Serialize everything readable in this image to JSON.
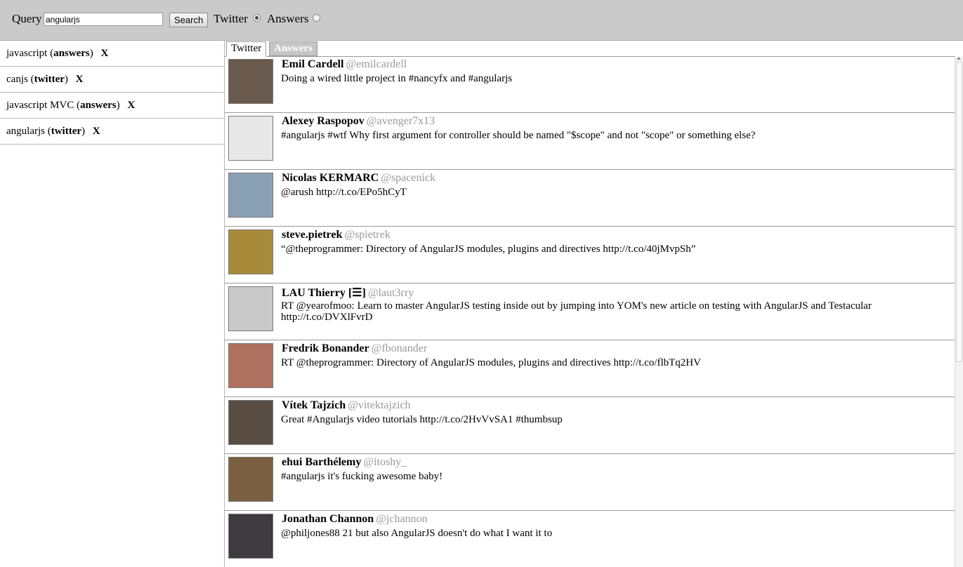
{
  "search": {
    "query_label": "Query",
    "query_value": "angularjs",
    "search_button": "Search",
    "source_twitter_label": "Twitter",
    "source_answers_label": "Answers",
    "selected_source": "Twitter"
  },
  "saved_searches": [
    {
      "term": "javascript",
      "source": "answers",
      "remove": "X"
    },
    {
      "term": "canjs",
      "source": "twitter",
      "remove": "X"
    },
    {
      "term": "javascript MVC",
      "source": "answers",
      "remove": "X"
    },
    {
      "term": "angularjs",
      "source": "twitter",
      "remove": "X"
    }
  ],
  "tabs": {
    "twitter": "Twitter",
    "answers": "Answers",
    "active": "Twitter"
  },
  "tweets": [
    {
      "name": "Emil Cardell",
      "handle": "@emilcardell",
      "text": "Doing a wired little project in #nancyfx and #angularjs",
      "avatar_color": "#6b5a4e"
    },
    {
      "name": "Alexey Raspopov",
      "handle": "@avenger7x13",
      "text": "#angularjs #wtf Why first argument for controller should be named \"$scope\" and not \"scope\" or something else?",
      "avatar_color": "#e8e8e8"
    },
    {
      "name": "Nicolas KERMARC",
      "handle": "@spacenick",
      "text": "@arush http://t.co/EPo5hCyT",
      "avatar_color": "#8aa0b4"
    },
    {
      "name": "steve.pietrek",
      "handle": "@spietrek",
      "text": "“@theprogrammer: Directory of AngularJS modules, plugins and directives http://t.co/40jMvpSh”",
      "avatar_color": "#a88b3a"
    },
    {
      "name": "LAU Thierry [☰]",
      "handle": "@laut3rry",
      "text": "RT @yearofmoo: Learn to master AngularJS testing inside out by jumping into YOM's new article on testing with AngularJS and Testacular http://t.co/DVXlFvrD",
      "avatar_color": "#c9c9c9"
    },
    {
      "name": "Fredrik Bonander",
      "handle": "@fbonander",
      "text": "RT @theprogrammer: Directory of AngularJS modules, plugins and directives http://t.co/flbTq2HV",
      "avatar_color": "#b07060"
    },
    {
      "name": "Vítek Tajzich",
      "handle": "@vitektajzich",
      "text": "Great #Angularjs video tutorials http://t.co/2HvVvSA1 #thumbsup",
      "avatar_color": "#5a4e44"
    },
    {
      "name": "ehui Barthélemy",
      "handle": "@itoshy_",
      "text": "#angularjs it's fucking awesome baby!",
      "avatar_color": "#7a6040"
    },
    {
      "name": "Jonathan Channon",
      "handle": "@jchannon",
      "text": "@philjones88 21 but also AngularJS doesn't do what I want it to",
      "avatar_color": "#3e3a40"
    }
  ]
}
